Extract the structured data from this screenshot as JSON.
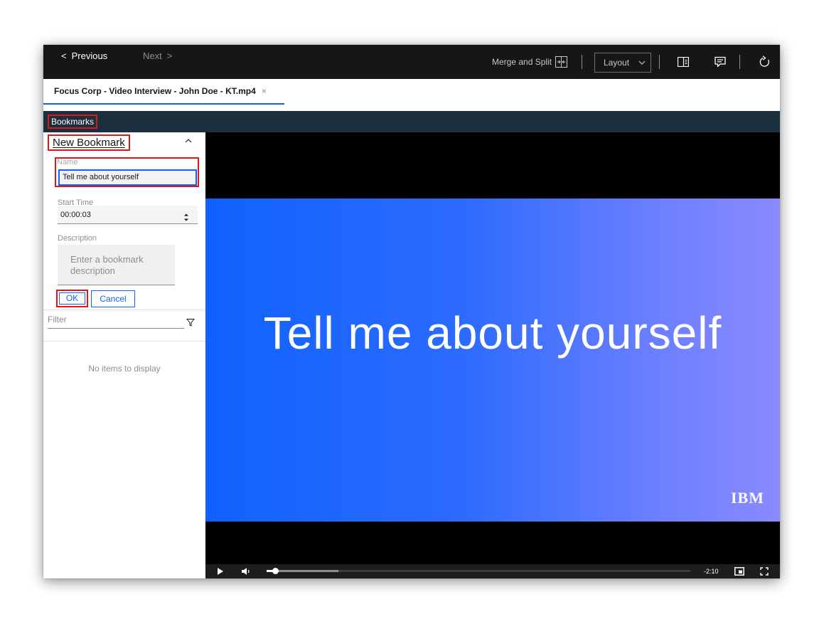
{
  "toolbar": {
    "prev_label": "Previous",
    "next_label": "Next",
    "merge_label": "Merge and Split",
    "layout_label": "Layout"
  },
  "tab": {
    "label": "Focus Corp - Video Interview - John Doe - KT.mp4",
    "close": "×"
  },
  "bookmarks_label": "Bookmarks",
  "new_bookmark": {
    "title": "New Bookmark",
    "name_label": "Name",
    "name_value": "Tell me about yourself",
    "start_time_label": "Start Time",
    "start_time_value": "00:00:03",
    "description_label": "Description",
    "description_placeholder": "Enter a bookmark description",
    "ok_label": "OK",
    "cancel_label": "Cancel"
  },
  "filter": {
    "placeholder": "Filter"
  },
  "list": {
    "empty_text": "No items to display"
  },
  "video": {
    "frame_text": "Tell me about yourself",
    "logo": "IBM",
    "time_remaining": "-2:10",
    "buffered_fraction": 0.17,
    "played_fraction": 0.02
  },
  "colors": {
    "accent": "#0f62fe",
    "highlight": "#e0161b",
    "toolbar_bg": "#161616",
    "bookmark_strip_bg": "#1c2f3e"
  }
}
